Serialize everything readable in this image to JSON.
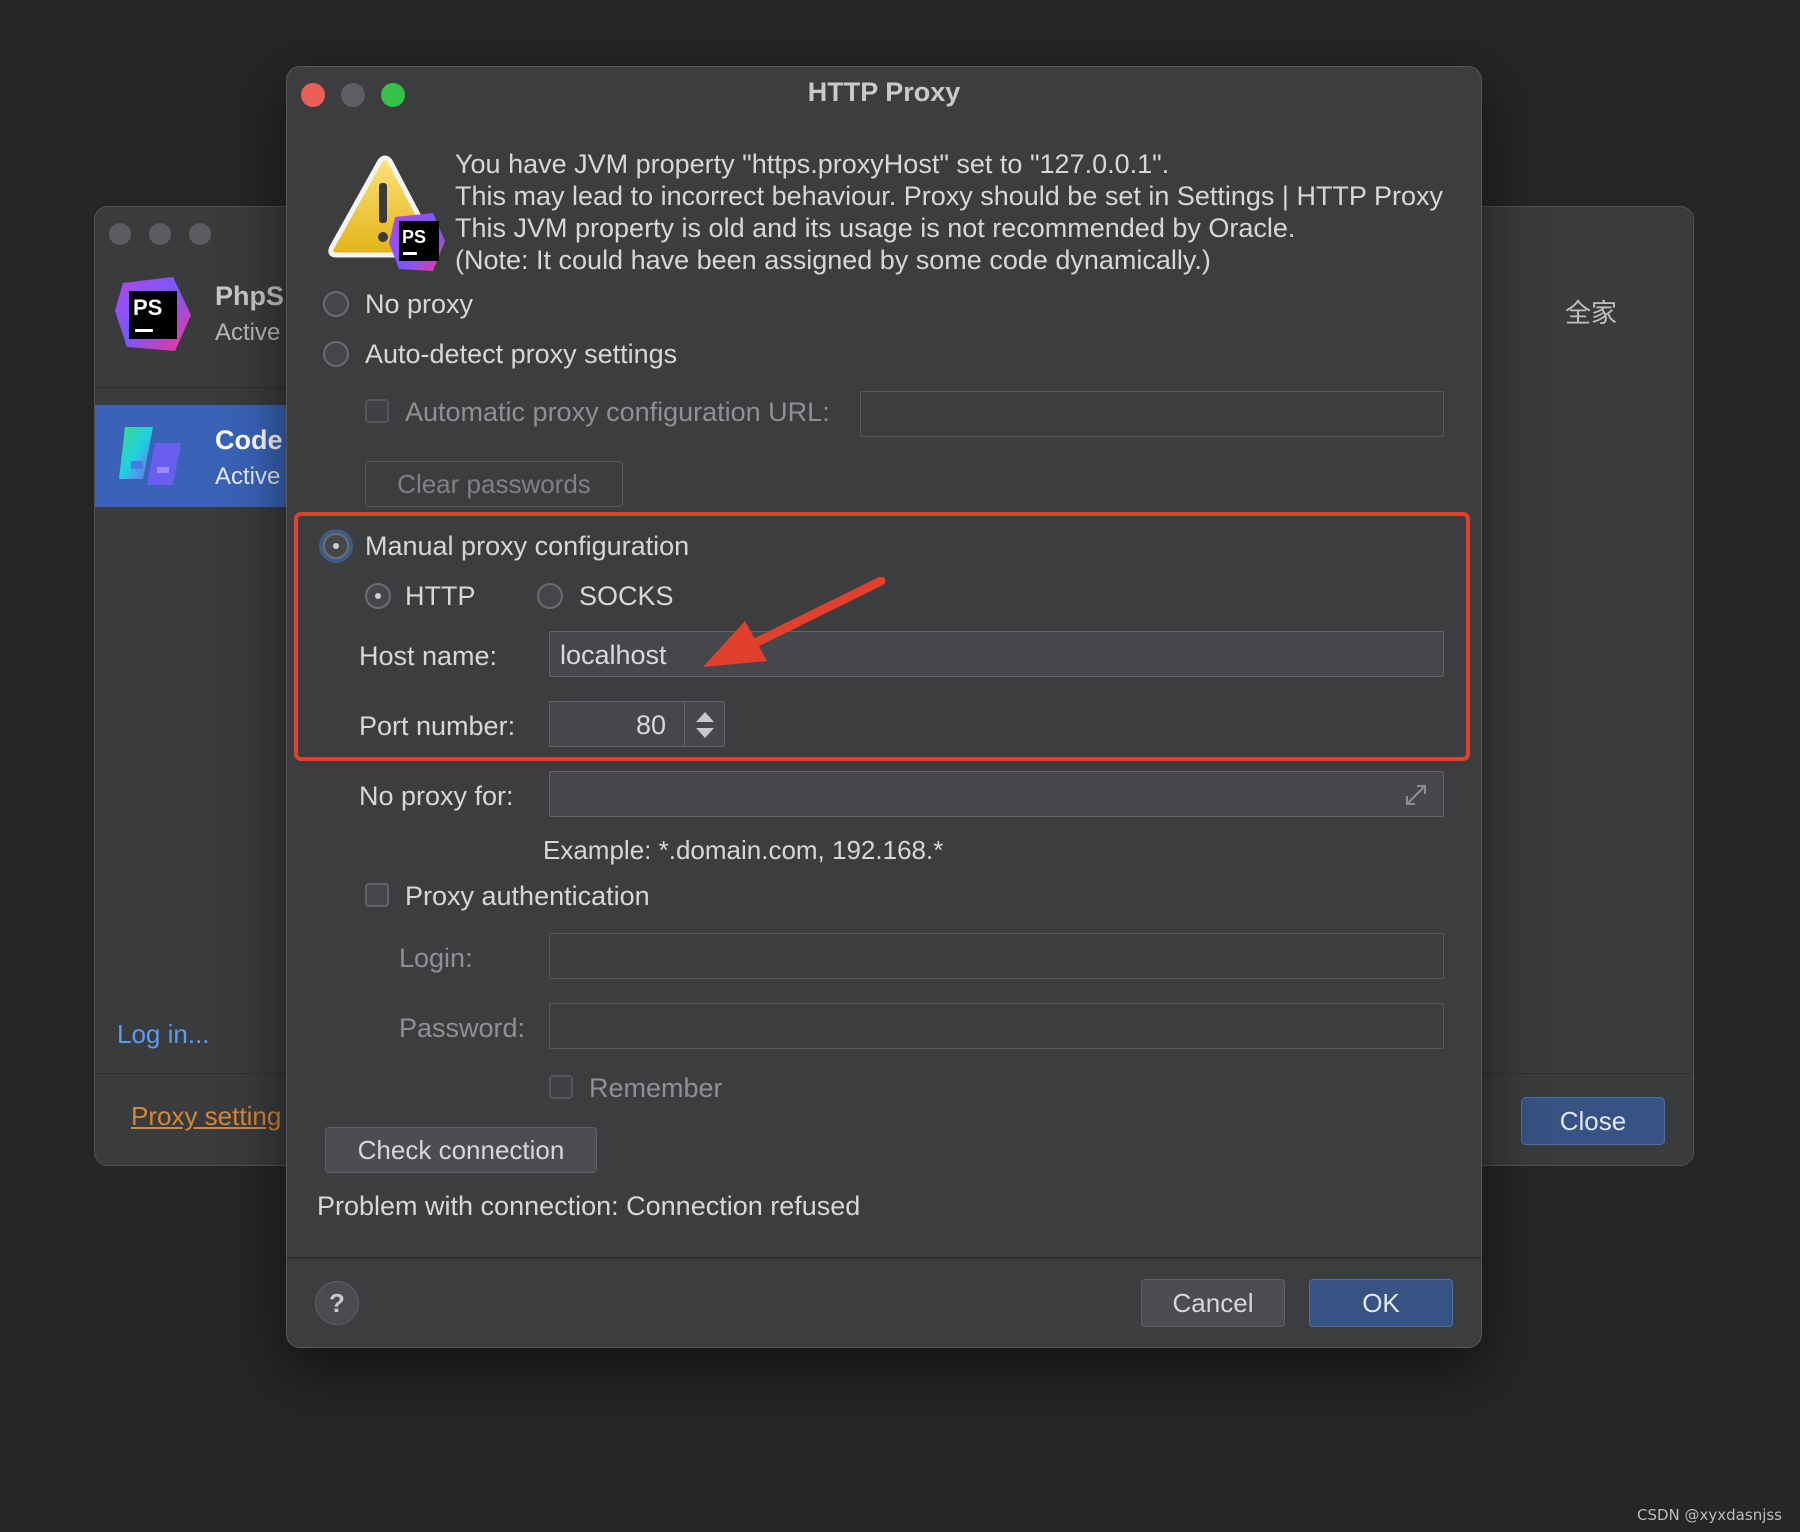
{
  "background_window": {
    "apps": [
      {
        "name": "PhpS",
        "status": "Active"
      },
      {
        "name": "Code",
        "status": "Active"
      }
    ],
    "login_link": "Log in...",
    "proxy_link": "Proxy setting",
    "cjk_text": "全家",
    "close_button": "Close",
    "ps_badge": "PS"
  },
  "dialog": {
    "title": "HTTP Proxy",
    "warning": {
      "lines": [
        "You have JVM property \"https.proxyHost\" set to \"127.0.0.1\".",
        "This may lead to incorrect behaviour. Proxy should be set in Settings | HTTP Proxy",
        "This JVM property is old and its usage is not recommended by Oracle.",
        "(Note: It could have been assigned by some code dynamically.)"
      ],
      "icon_badge": "PS"
    },
    "options": {
      "no_proxy": "No proxy",
      "auto_detect": "Auto-detect proxy settings",
      "auto_url_label": "Automatic proxy configuration URL:",
      "auto_url_value": "",
      "clear_passwords": "Clear passwords",
      "manual": "Manual proxy configuration",
      "selected": "manual"
    },
    "manual": {
      "protocols": [
        "HTTP",
        "SOCKS"
      ],
      "selected_protocol": "HTTP",
      "host_label": "Host name:",
      "host_value": "localhost",
      "port_label": "Port number:",
      "port_value": "80",
      "no_proxy_label": "No proxy for:",
      "no_proxy_value": "",
      "example": "Example: *.domain.com, 192.168.*"
    },
    "auth": {
      "checkbox_label": "Proxy authentication",
      "login_label": "Login:",
      "password_label": "Password:",
      "remember_label": "Remember"
    },
    "check_button": "Check connection",
    "status": "Problem with connection: Connection refused",
    "cancel": "Cancel",
    "ok": "OK",
    "help": "?"
  },
  "colors": {
    "highlight": "#e0402c",
    "primary_button": "#375383",
    "link": "#5b9cf2",
    "proxy_link": "#d4873d"
  },
  "watermark": "CSDN @xyxdasnjss"
}
